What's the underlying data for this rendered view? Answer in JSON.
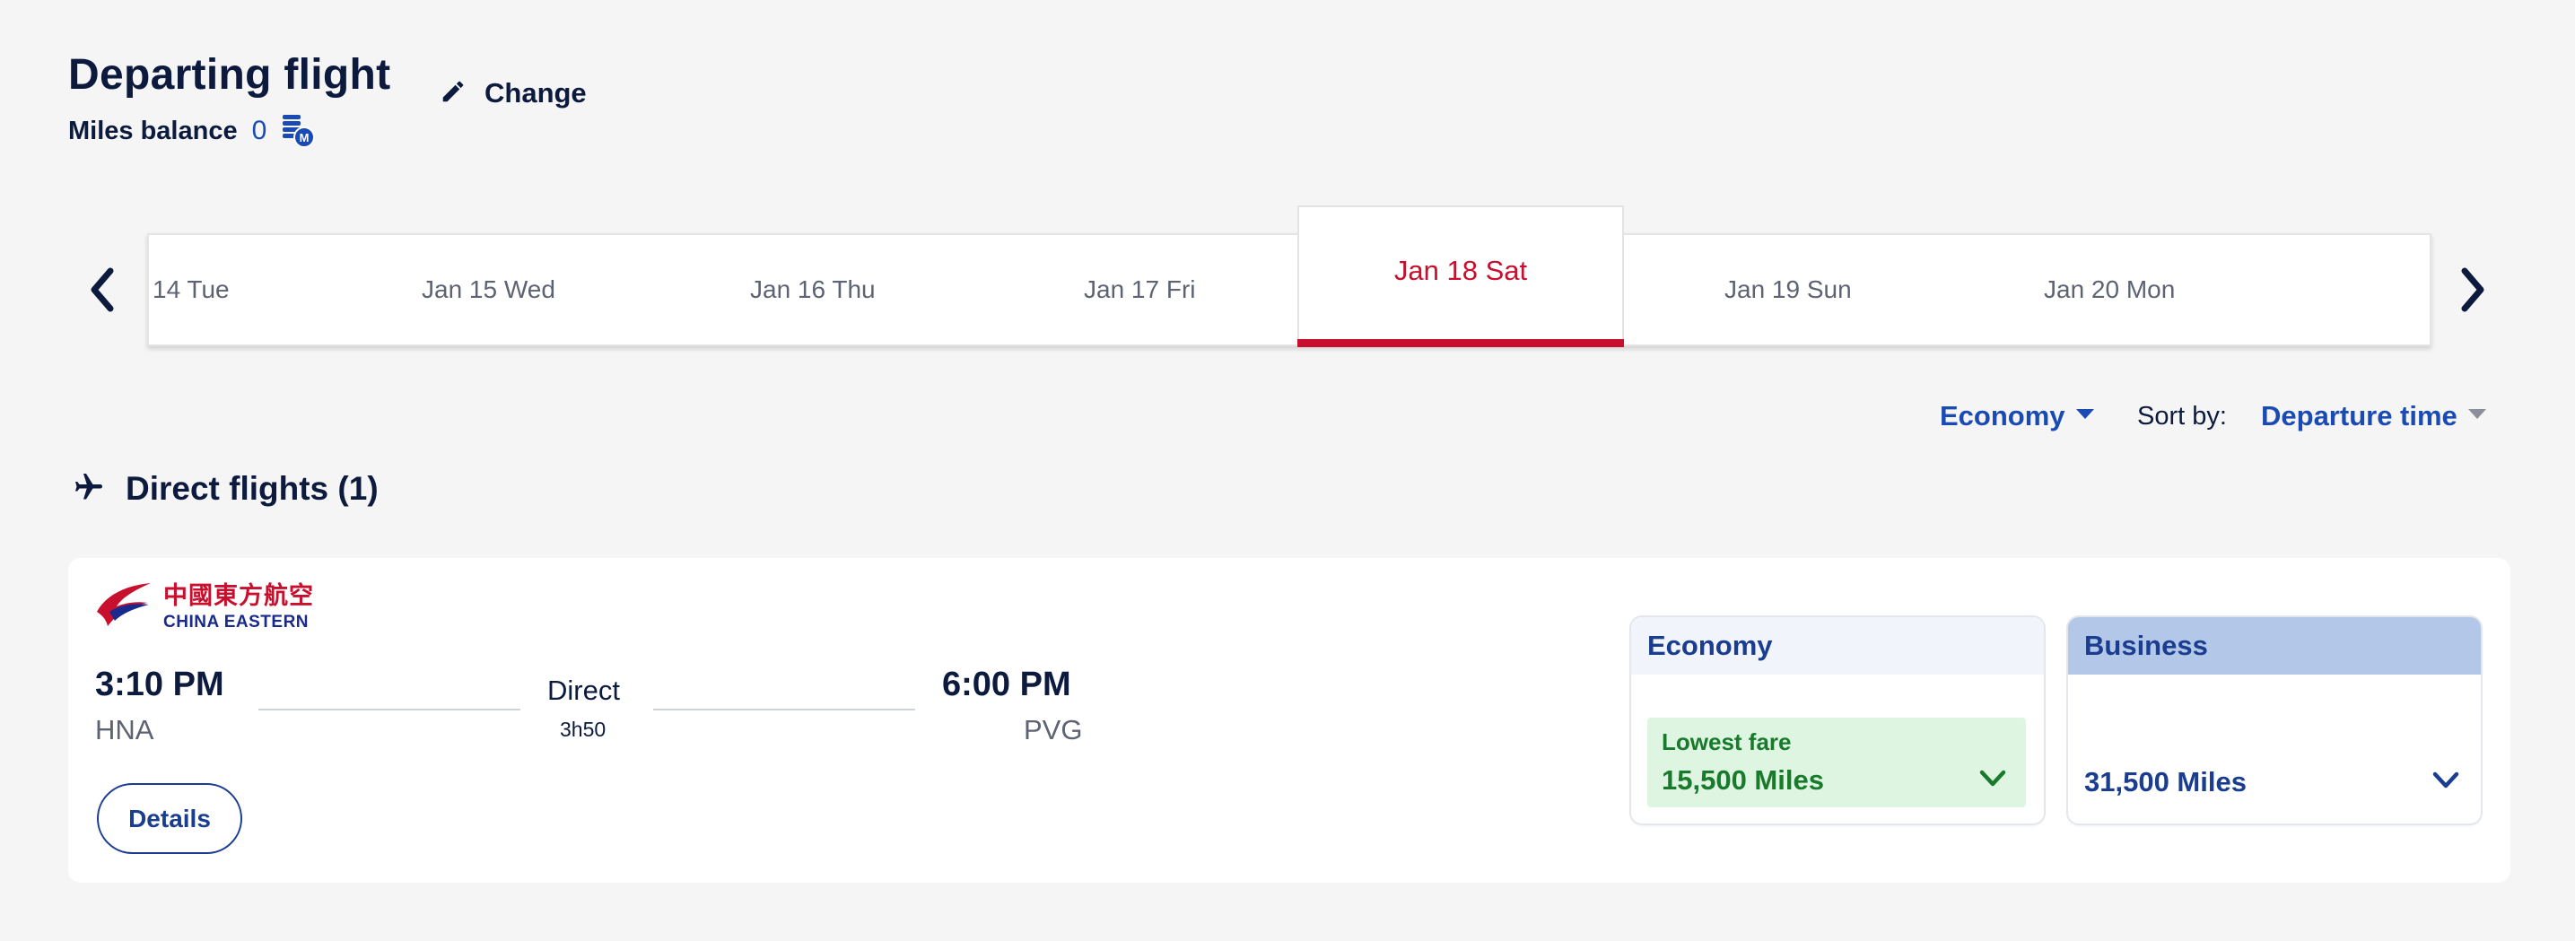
{
  "header": {
    "title": "Departing flight",
    "change_label": "Change",
    "miles_balance_label": "Miles balance",
    "miles_balance_value": "0"
  },
  "dates": {
    "items": [
      "14 Tue",
      "Jan 15 Wed",
      "Jan 16 Thu",
      "Jan 17 Fri",
      "Jan 19 Sun",
      "Jan 20 Mon"
    ],
    "selected": "Jan 18 Sat",
    "selected_color": "#c8102e"
  },
  "filters": {
    "cabin": "Economy",
    "sort_label": "Sort by:",
    "sort_value": "Departure time"
  },
  "section": {
    "title": "Direct flights (1)"
  },
  "flight": {
    "airline_cn": "中國東方航空",
    "airline_en": "CHINA EASTERN",
    "depart_time": "3:10 PM",
    "depart_code": "HNA",
    "arrive_time": "6:00 PM",
    "arrive_code": "PVG",
    "stops": "Direct",
    "duration": "3h50",
    "details_label": "Details"
  },
  "fares": {
    "economy": {
      "label": "Economy",
      "badge": "Lowest fare",
      "miles": "15,500 Miles"
    },
    "business": {
      "label": "Business",
      "miles": "31,500 Miles"
    }
  },
  "colors": {
    "brand_navy": "#0c1a3d",
    "link_blue": "#1a4bb5",
    "accent_red": "#c8102e",
    "fare_green": "#1a7a2c"
  }
}
